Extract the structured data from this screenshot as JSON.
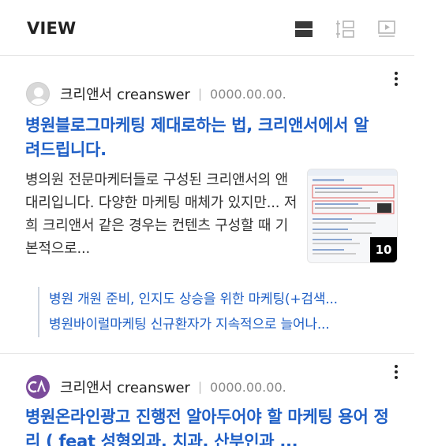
{
  "header": {
    "title": "VIEW"
  },
  "view_modes": [
    {
      "icon": "card-view-icon",
      "active": true
    },
    {
      "icon": "list-view-icon",
      "active": false
    },
    {
      "icon": "video-view-icon",
      "active": false
    }
  ],
  "posts": [
    {
      "author": "크리앤서 creanswer",
      "date": "0000.00.00.",
      "title": "병원블로그마케팅 제대로하는 법, 크리앤서에서 알려드립니다.",
      "description": "병의원 전문마케터들로 구성된 크리앤서의 앤대리입니다. 다양한 마케팅 매체가 있지만... 저희 크리앤서 같은 경우는 컨텐츠 구성할 때 기본적으로...",
      "image_count": "10",
      "related": [
        "병원 개원 준비, 인지도 상승을 위한 마케팅(+검색...",
        "병원바이럴마케팅 신규환자가 지속적으로 늘어나..."
      ]
    },
    {
      "author": "크리앤서 creanswer",
      "date": "0000.00.00.",
      "title": "병원온라인광고 진행전 알아두어야 할 마케팅 용어 정리 ( feat 성형외과, 치과, 산부인과 ..."
    }
  ],
  "colors": {
    "title_link": "#1f5fc6",
    "brand_avatar": "#7b4b9b"
  }
}
